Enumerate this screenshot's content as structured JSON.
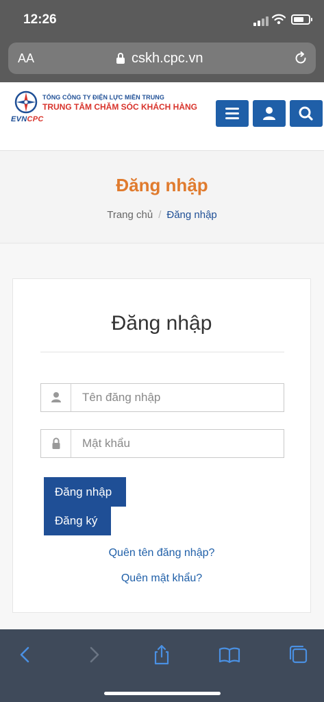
{
  "status_bar": {
    "time": "12:26"
  },
  "browser": {
    "text_size_label": "AA",
    "url": "cskh.cpc.vn"
  },
  "header": {
    "company_line": "TỔNG CÔNG TY ĐIỆN LỰC MIỀN TRUNG",
    "center_line": "TRUNG TÂM CHĂM SÓC KHÁCH HÀNG",
    "brand_evn": "EVN",
    "brand_cpc": "CPC",
    "brand_colors": {
      "blue": "#1f4f96",
      "red": "#d8332b"
    },
    "buttons": [
      "menu-icon",
      "user-icon",
      "search-icon"
    ]
  },
  "banner": {
    "title": "Đăng nhập",
    "breadcrumb_home": "Trang chủ",
    "breadcrumb_separator": "/",
    "breadcrumb_current": "Đăng nhập"
  },
  "login_form": {
    "title": "Đăng nhập",
    "username_placeholder": "Tên đăng nhập",
    "username_value": "",
    "password_placeholder": "Mật khẩu",
    "password_value": "",
    "login_button": "Đăng nhập",
    "register_button": "Đăng ký",
    "forgot_username": "Quên tên đăng nhập?",
    "forgot_password": "Quên mật khẩu?"
  },
  "toolbar": {
    "icons": [
      "back-icon",
      "forward-icon",
      "share-icon",
      "bookmarks-icon",
      "tabs-icon"
    ]
  }
}
